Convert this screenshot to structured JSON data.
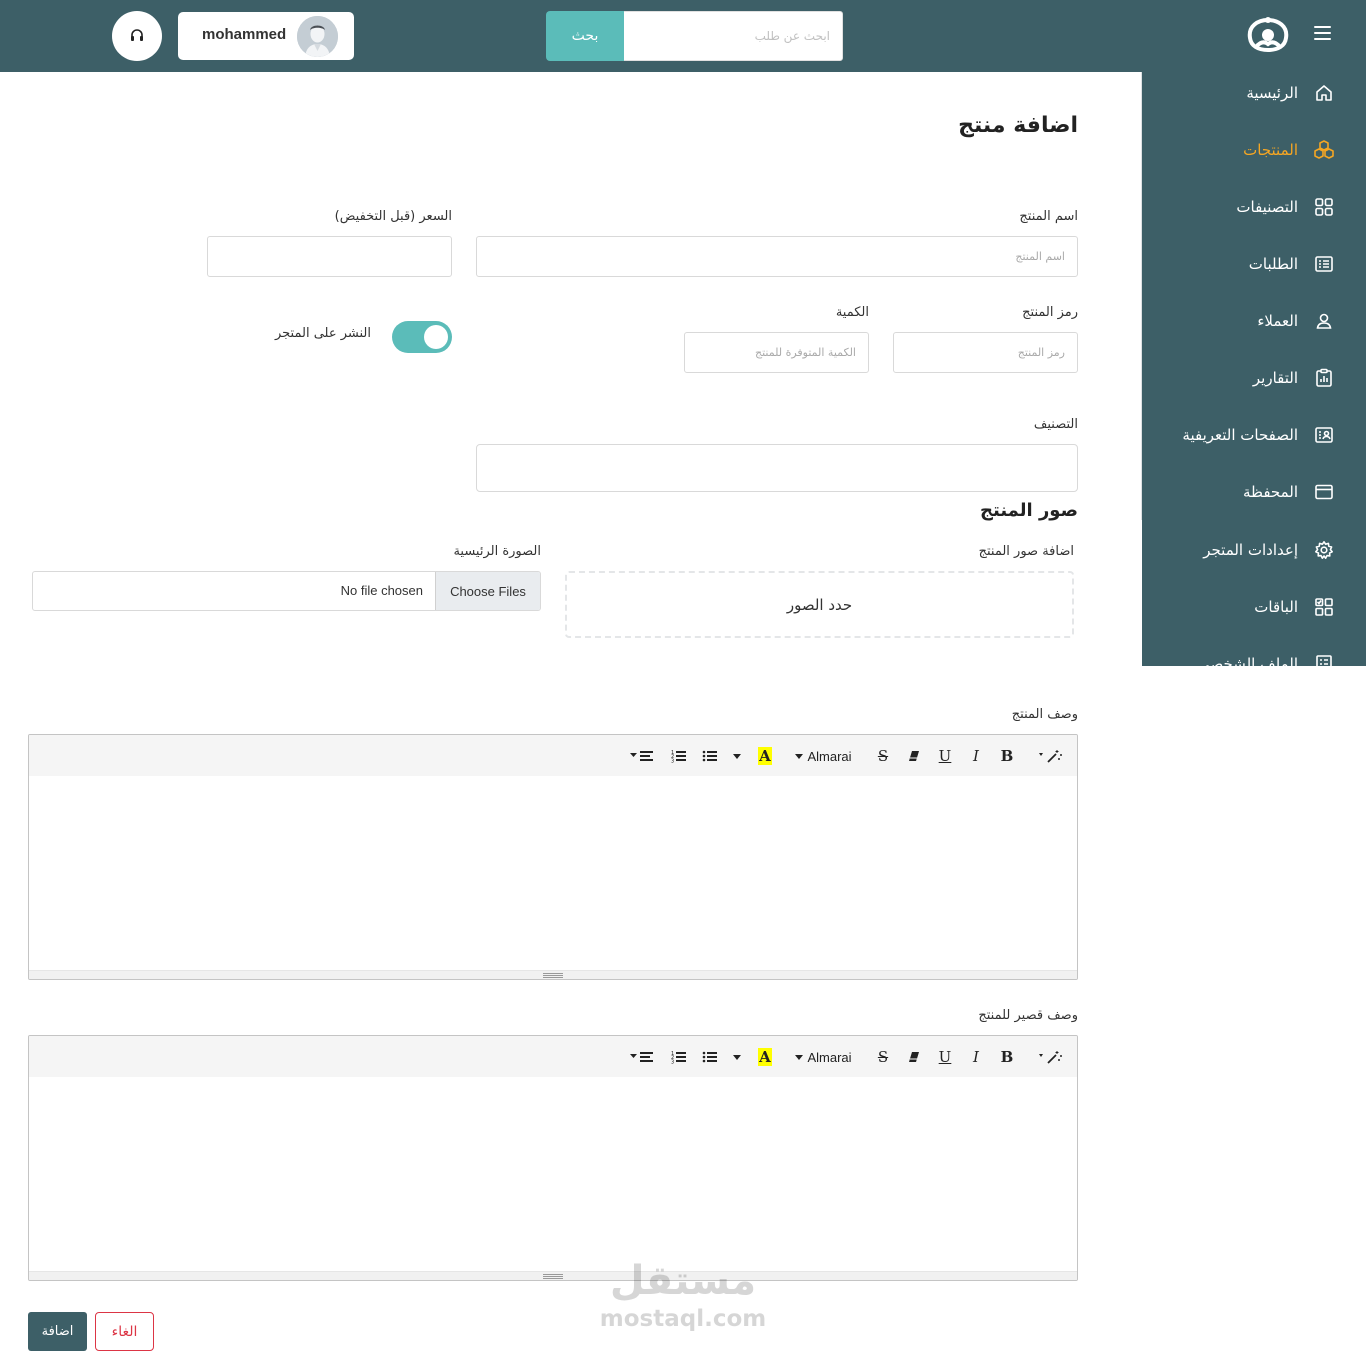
{
  "header": {
    "search_placeholder": "ابحث عن طلب",
    "search_button": "بحث",
    "user_name": "mohammed"
  },
  "sidebar": {
    "items": [
      {
        "label": "الرئيسية",
        "icon": "home-icon",
        "active": false
      },
      {
        "label": "المنتجات",
        "icon": "products-icon",
        "active": true
      },
      {
        "label": "التصنيفات",
        "icon": "categories-icon",
        "active": false
      },
      {
        "label": "الطلبات",
        "icon": "orders-icon",
        "active": false
      },
      {
        "label": "العملاء",
        "icon": "customers-icon",
        "active": false
      },
      {
        "label": "التقارير",
        "icon": "reports-icon",
        "active": false
      },
      {
        "label": "الصفحات التعريفية",
        "icon": "pages-icon",
        "active": false
      },
      {
        "label": "المحفظة",
        "icon": "wallet-icon",
        "active": false
      },
      {
        "label": "إعدادات المتجر",
        "icon": "settings-icon",
        "active": false
      },
      {
        "label": "الباقات",
        "icon": "packages-icon",
        "active": false
      },
      {
        "label": "الملف الشخصي",
        "icon": "profile-icon",
        "active": false
      }
    ]
  },
  "form": {
    "title": "اضافة منتج",
    "product_name_label": "اسم المنتج",
    "product_name_placeholder": "اسم المنتج",
    "price_label": "السعر (قبل التخفيض)",
    "price_value": "",
    "sku_label": "رمز المنتج",
    "sku_placeholder": "رمز المنتج",
    "quantity_label": "الكمية",
    "quantity_placeholder": "الكمية المتوفرة للمنتج",
    "publish_label": "النشر على المتجر",
    "publish_on": true,
    "category_label": "التصنيف",
    "category_value": "",
    "images_section_title": "صور المنتج",
    "add_images_label": "اضافة صور المنتج",
    "dropzone_text": "حدد الصور",
    "main_image_label": "الصورة الرئيسية",
    "choose_files": "Choose Files",
    "no_file": "No file chosen",
    "description_label": "وصف المنتج",
    "short_description_label": "وصف قصير للمنتج",
    "editor_font": "Almarai",
    "add_button": "اضافة",
    "cancel_button": "الغاء"
  },
  "watermark": {
    "arabic": "مستقل",
    "latin": "mostaql.com"
  },
  "colors": {
    "primary": "#3d5f67",
    "accent": "#5bbcb9",
    "active_nav": "#f5a623",
    "danger": "#dc3545"
  }
}
